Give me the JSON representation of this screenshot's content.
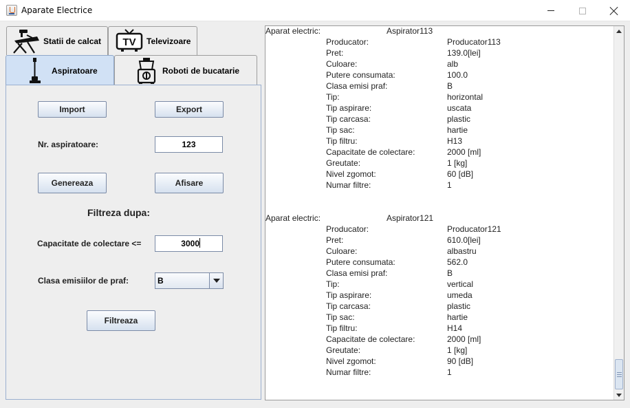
{
  "window": {
    "title": "Aparate Electrice",
    "icon": "java-cup-icon"
  },
  "tabs": {
    "row1": [
      {
        "label": "Statii de calcat",
        "icon": "iron-icon"
      },
      {
        "label": "Televizoare",
        "icon": "tv-icon",
        "icon_text": "TV"
      }
    ],
    "row2": [
      {
        "label": "Aspiratoare",
        "icon": "vacuum-icon",
        "selected": true
      },
      {
        "label": "Roboti de bucatarie",
        "icon": "food-processor-icon"
      }
    ]
  },
  "panel": {
    "import_label": "Import",
    "export_label": "Export",
    "count_label": "Nr. aspiratoare:",
    "count_value": "123",
    "generate_label": "Genereaza",
    "display_label": "Afisare",
    "filter_heading": "Filtreza dupa:",
    "capacity_label": "Capacitate de colectare <=",
    "capacity_value": "3000",
    "dust_class_label": "Clasa emisiilor de praf:",
    "dust_class_selected": "B",
    "filter_button_label": "Filtreaza"
  },
  "output": {
    "header_key": "Aparat electric:",
    "records": [
      {
        "name": "Aspirator113",
        "fields": [
          {
            "key": "Producator:",
            "value": "Producator113"
          },
          {
            "key": "Pret:",
            "value": "139.0[lei]"
          },
          {
            "key": "Culoare:",
            "value": "alb"
          },
          {
            "key": "Putere consumata:",
            "value": "100.0"
          },
          {
            "key": "Clasa emisi praf:",
            "value": "B"
          },
          {
            "key": "Tip:",
            "value": "horizontal"
          },
          {
            "key": "Tip aspirare:",
            "value": "uscata"
          },
          {
            "key": "Tip carcasa:",
            "value": "plastic"
          },
          {
            "key": "Tip sac:",
            "value": "hartie"
          },
          {
            "key": "Tip filtru:",
            "value": "H13"
          },
          {
            "key": "Capacitate de colectare:",
            "value": "2000 [ml]"
          },
          {
            "key": "Greutate:",
            "value": "1 [kg]"
          },
          {
            "key": "Nivel zgomot:",
            "value": "60 [dB]"
          },
          {
            "key": "Numar filtre:",
            "value": "1"
          }
        ]
      },
      {
        "name": "Aspirator121",
        "fields": [
          {
            "key": "Producator:",
            "value": "Producator121"
          },
          {
            "key": "Pret:",
            "value": "610.0[lei]"
          },
          {
            "key": "Culoare:",
            "value": "albastru"
          },
          {
            "key": "Putere consumata:",
            "value": "562.0"
          },
          {
            "key": "Clasa emisi praf:",
            "value": "B"
          },
          {
            "key": "Tip:",
            "value": "vertical"
          },
          {
            "key": "Tip aspirare:",
            "value": "umeda"
          },
          {
            "key": "Tip carcasa:",
            "value": "plastic"
          },
          {
            "key": "Tip sac:",
            "value": "hartie"
          },
          {
            "key": "Tip filtru:",
            "value": "H14"
          },
          {
            "key": "Capacitate de colectare:",
            "value": "2000 [ml]"
          },
          {
            "key": "Greutate:",
            "value": "1 [kg]"
          },
          {
            "key": "Nivel zgomot:",
            "value": "90 [dB]"
          },
          {
            "key": "Numar filtre:",
            "value": "1"
          }
        ]
      }
    ]
  },
  "scrollbar": {
    "position_fraction": 0.97
  },
  "colors": {
    "selected_tab": "#d1e1f5",
    "button_border": "#7a8aa6"
  }
}
